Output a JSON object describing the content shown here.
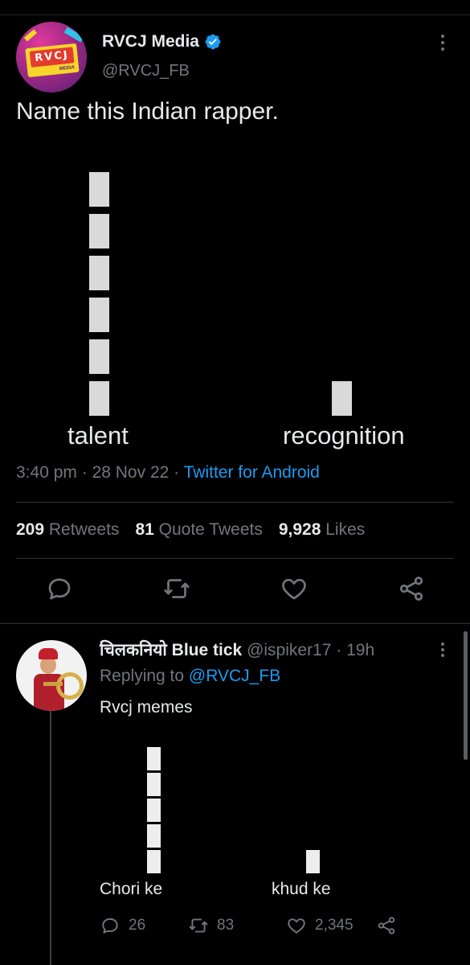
{
  "main_tweet": {
    "display_name": "RVCJ Media",
    "handle": "@RVCJ_FB",
    "avatar_logo_text": "RVCJ",
    "avatar_logo_sub": "MEDIA",
    "text": "Name this Indian rapper.",
    "chart_data": {
      "type": "bar",
      "categories": [
        "talent",
        "recognition"
      ],
      "values": [
        6,
        1
      ],
      "title": "",
      "xlabel": "",
      "ylabel": ""
    },
    "time": "3:40 pm",
    "separator": "·",
    "date": "28 Nov 22",
    "source": "Twitter for Android",
    "stats": {
      "retweets_count": "209",
      "retweets_label": "Retweets",
      "quotes_count": "81",
      "quotes_label": "Quote Tweets",
      "likes_count": "9,928",
      "likes_label": "Likes"
    },
    "actions": [
      "reply-icon",
      "retweet-icon",
      "like-icon",
      "share-icon"
    ],
    "verified_color": "#1d9bf0"
  },
  "reply_tweet": {
    "display_name": "चिलकनियो Blue tick",
    "handle": "@ispiker17",
    "separator": "·",
    "age": "19h",
    "replying_prefix": "Replying to",
    "replying_to": "@RVCJ_FB",
    "text": "Rvcj memes",
    "chart_data": {
      "type": "bar",
      "categories": [
        "Chori ke",
        "khud ke"
      ],
      "values": [
        5,
        1
      ],
      "title": "",
      "xlabel": "",
      "ylabel": ""
    },
    "counts": {
      "replies": "26",
      "retweets": "83",
      "likes": "2,345"
    }
  },
  "colors": {
    "background": "#000000",
    "text": "#e7e9ea",
    "muted": "#71767b",
    "accent": "#1d9bf0",
    "bar": "#d9d9d9"
  }
}
